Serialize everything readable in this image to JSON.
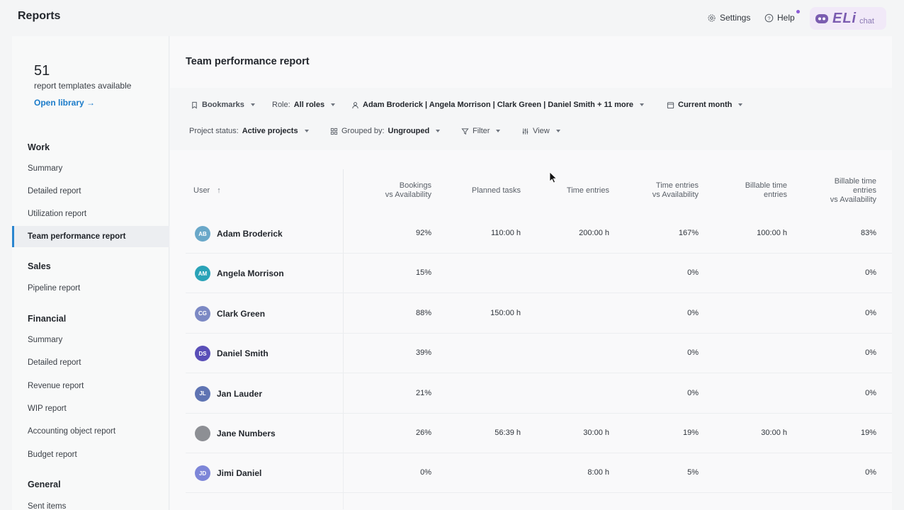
{
  "app": {
    "title": "Reports"
  },
  "top": {
    "settings": "Settings",
    "help": "Help",
    "eli_logo": "ELi",
    "eli_chat": "chat"
  },
  "sidebar": {
    "library_count": "51",
    "library_text": "report templates available",
    "library_link": "Open library →",
    "sections": [
      {
        "title": "Work",
        "items": [
          "Summary",
          "Detailed report",
          "Utilization report",
          "Team performance report"
        ]
      },
      {
        "title": "Sales",
        "items": [
          "Pipeline report"
        ]
      },
      {
        "title": "Financial",
        "items": [
          "Summary",
          "Detailed report",
          "Revenue report",
          "WIP report",
          "Accounting object report",
          "Budget report"
        ]
      },
      {
        "title": "General",
        "items": [
          "Sent items"
        ]
      }
    ],
    "active_item": "Team performance report"
  },
  "main": {
    "title": "Team performance report",
    "filters": {
      "bookmarks": "Bookmarks",
      "role_label": "Role:",
      "role_value": "All roles",
      "users": "Adam Broderick | Angela Morrison | Clark Green | Daniel Smith + 11 more",
      "period": "Current month",
      "project_status_label": "Project status:",
      "project_status_value": "Active projects",
      "grouped_label": "Grouped by:",
      "grouped_value": "Ungrouped",
      "filter": "Filter",
      "view": "View"
    },
    "table": {
      "col_user": "User",
      "col_sort": "↑",
      "columns": [
        [
          "Bookings",
          "vs Availability"
        ],
        [
          "Planned tasks"
        ],
        [
          "Time entries"
        ],
        [
          "Time entries",
          "vs Availability"
        ],
        [
          "Billable time",
          "entries"
        ],
        [
          "Billable time",
          "entries",
          "vs Availability"
        ]
      ],
      "rows": [
        {
          "initials": "AB",
          "name": "Adam Broderick",
          "color": "#6aa8c9",
          "values": [
            "92%",
            "110:00 h",
            "200:00 h",
            "167%",
            "100:00 h",
            "83%"
          ]
        },
        {
          "initials": "AM",
          "name": "Angela Morrison",
          "color": "#2aa3b8",
          "values": [
            "15%",
            "",
            "",
            "0%",
            "",
            "0%"
          ]
        },
        {
          "initials": "CG",
          "name": "Clark Green",
          "color": "#7c89c4",
          "values": [
            "88%",
            "150:00 h",
            "",
            "0%",
            "",
            "0%"
          ]
        },
        {
          "initials": "DS",
          "name": "Daniel Smith",
          "color": "#5a4fb8",
          "values": [
            "39%",
            "",
            "",
            "0%",
            "",
            "0%"
          ]
        },
        {
          "initials": "JL",
          "name": "Jan Lauder",
          "color": "#5f74b3",
          "values": [
            "21%",
            "",
            "",
            "0%",
            "",
            "0%"
          ]
        },
        {
          "initials": "",
          "name": "Jane Numbers",
          "color": "#8d8f94",
          "values": [
            "26%",
            "56:39 h",
            "30:00 h",
            "19%",
            "30:00 h",
            "19%"
          ]
        },
        {
          "initials": "JD",
          "name": "Jimi Daniel",
          "color": "#7d86d8",
          "values": [
            "0%",
            "",
            "8:00 h",
            "5%",
            "",
            "0%"
          ]
        }
      ]
    }
  }
}
